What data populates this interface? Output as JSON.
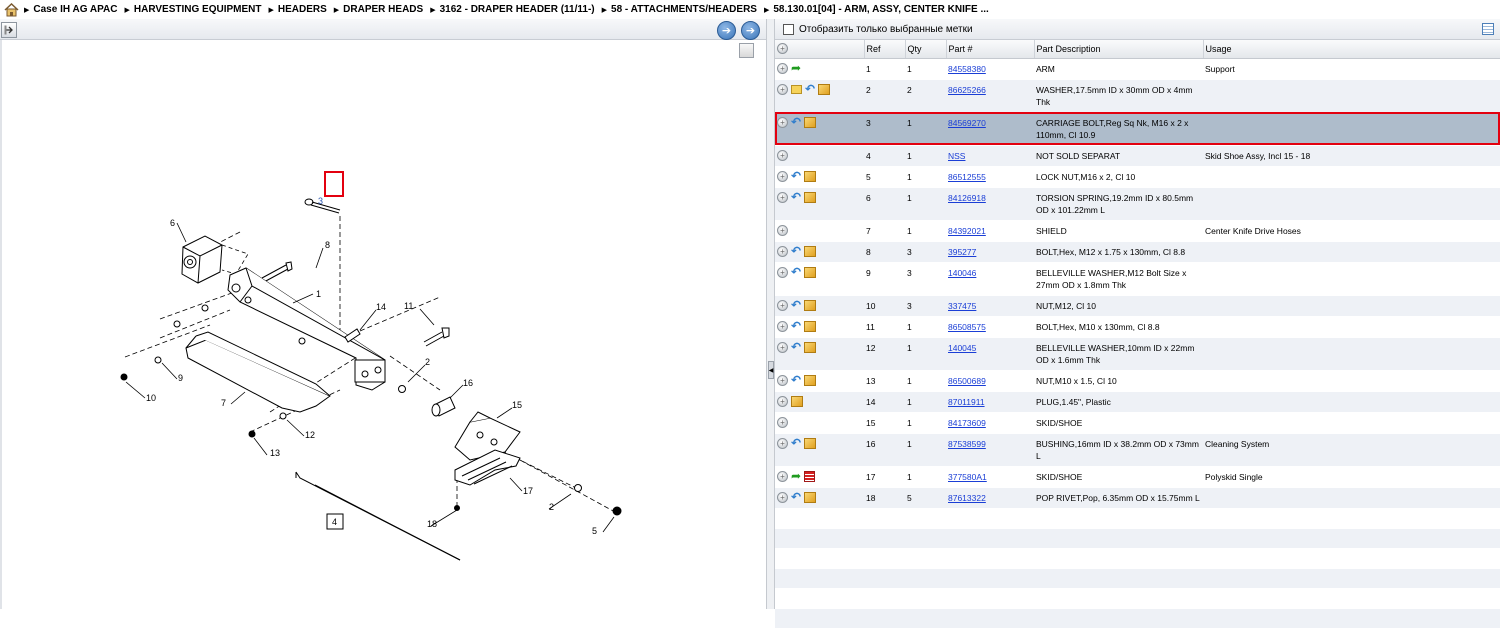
{
  "breadcrumb": [
    "Case IH AG APAC",
    "HARVESTING EQUIPMENT",
    "HEADERS",
    "DRAPER HEADS",
    "3162 - DRAPER HEADER (11/11-)",
    "58 - ATTACHMENTS/HEADERS",
    "58.130.01[04] - ARM, ASSY, CENTER KNIFE ..."
  ],
  "filter": {
    "label": "Отобразить только выбранные метки",
    "checked": false
  },
  "columns": {
    "ref": "Ref",
    "qty": "Qty",
    "part": "Part #",
    "desc": "Part Description",
    "usage": "Usage"
  },
  "rows": [
    {
      "icons": [
        "green-arrow-icon"
      ],
      "ref": "1",
      "qty": "1",
      "part": "84558380",
      "desc": "ARM",
      "usage": "Support"
    },
    {
      "icons": [
        "note-icon",
        "blue-arrow-icon",
        "box-icon"
      ],
      "ref": "2",
      "qty": "2",
      "part": "86625266",
      "desc": "WASHER,17.5mm ID x 30mm OD x 4mm Thk",
      "usage": ""
    },
    {
      "icons": [
        "blue-arrow-icon",
        "box-icon"
      ],
      "ref": "3",
      "qty": "1",
      "part": "84569270",
      "desc": "CARRIAGE BOLT,Reg Sq Nk, M16 x 2 x 110mm, Cl 10.9",
      "usage": "",
      "selected": true
    },
    {
      "icons": [],
      "ref": "4",
      "qty": "1",
      "part": "NSS",
      "desc": "NOT SOLD SEPARAT",
      "usage": "Skid Shoe Assy, Incl 15 - 18"
    },
    {
      "icons": [
        "blue-arrow-icon",
        "box-icon"
      ],
      "ref": "5",
      "qty": "1",
      "part": "86512555",
      "desc": "LOCK NUT,M16 x 2, Cl 10",
      "usage": ""
    },
    {
      "icons": [
        "blue-arrow-icon",
        "box-icon"
      ],
      "ref": "6",
      "qty": "1",
      "part": "84126918",
      "desc": "TORSION SPRING,19.2mm ID x 80.5mm OD x 101.22mm L",
      "usage": ""
    },
    {
      "icons": [],
      "ref": "7",
      "qty": "1",
      "part": "84392021",
      "desc": "SHIELD",
      "usage": "Center Knife Drive Hoses"
    },
    {
      "icons": [
        "blue-arrow-icon",
        "box-icon"
      ],
      "ref": "8",
      "qty": "3",
      "part": "395277",
      "desc": "BOLT,Hex, M12 x 1.75 x 130mm, Cl 8.8",
      "usage": ""
    },
    {
      "icons": [
        "blue-arrow-icon",
        "box-icon"
      ],
      "ref": "9",
      "qty": "3",
      "part": "140046",
      "desc": "BELLEVILLE WASHER,M12 Bolt Size x 27mm OD x 1.8mm Thk",
      "usage": ""
    },
    {
      "icons": [
        "blue-arrow-icon",
        "box-icon"
      ],
      "ref": "10",
      "qty": "3",
      "part": "337475",
      "desc": "NUT,M12, Cl 10",
      "usage": ""
    },
    {
      "icons": [
        "blue-arrow-icon",
        "box-icon"
      ],
      "ref": "11",
      "qty": "1",
      "part": "86508575",
      "desc": "BOLT,Hex, M10 x 130mm, Cl 8.8",
      "usage": ""
    },
    {
      "icons": [
        "blue-arrow-icon",
        "box-icon"
      ],
      "ref": "12",
      "qty": "1",
      "part": "140045",
      "desc": "BELLEVILLE WASHER,10mm ID x 22mm OD x 1.6mm Thk",
      "usage": ""
    },
    {
      "icons": [
        "blue-arrow-icon",
        "box-icon"
      ],
      "ref": "13",
      "qty": "1",
      "part": "86500689",
      "desc": "NUT,M10 x 1.5, Cl 10",
      "usage": ""
    },
    {
      "icons": [
        "box-icon"
      ],
      "ref": "14",
      "qty": "1",
      "part": "87011911",
      "desc": "PLUG,1.45\", Plastic",
      "usage": ""
    },
    {
      "icons": [],
      "ref": "15",
      "qty": "1",
      "part": "84173609",
      "desc": "SKID/SHOE",
      "usage": ""
    },
    {
      "icons": [
        "blue-arrow-icon",
        "box-icon"
      ],
      "ref": "16",
      "qty": "1",
      "part": "87538599",
      "desc": "BUSHING,16mm ID x 38.2mm OD x 73mm L",
      "usage": "Cleaning System"
    },
    {
      "icons": [
        "green-arrow-icon",
        "list-icon"
      ],
      "ref": "17",
      "qty": "1",
      "part": "377580A1",
      "desc": "SKID/SHOE",
      "usage": "Polyskid Single"
    },
    {
      "icons": [
        "blue-arrow-icon",
        "box-icon"
      ],
      "ref": "18",
      "qty": "5",
      "part": "87613322",
      "desc": "POP RIVET,Pop, 6.35mm OD x 15.75mm L",
      "usage": ""
    }
  ],
  "diagram_callouts": [
    "1",
    "2",
    "2",
    "3",
    "4",
    "5",
    "6",
    "7",
    "8",
    "9",
    "10",
    "11",
    "12",
    "13",
    "14",
    "16",
    "15",
    "17",
    "18"
  ],
  "highlight_color": "#e3000f",
  "selected_row_color": "#aebccb"
}
